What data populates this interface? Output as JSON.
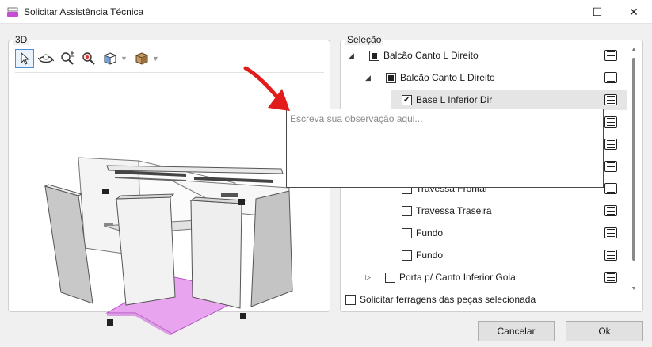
{
  "window": {
    "title": "Solicitar Assistência Técnica",
    "accent": "#c84bd6",
    "controls": {
      "minimize": "—",
      "maximize": "☐",
      "close": "✕"
    }
  },
  "panel_3d": {
    "label": "3D",
    "toolbar": [
      {
        "icon": "cursor-icon",
        "selected": true
      },
      {
        "icon": "orbit-icon"
      },
      {
        "icon": "zoom-plus-minus-icon"
      },
      {
        "icon": "zoom-fit-icon"
      },
      {
        "icon": "view-cube-icon",
        "dropdown": true
      },
      {
        "icon": "box-material-icon",
        "dropdown": true
      }
    ],
    "highlight_color": "#e8a4ef"
  },
  "panel_selection": {
    "label": "Seleção",
    "tree": [
      {
        "label": "Balcão Canto L Direito",
        "state": "partial",
        "expander": "expanded"
      },
      {
        "label": "Balcão Canto L Direito",
        "state": "partial",
        "expander": "expanded"
      },
      {
        "label": "Base L Inferior Dir",
        "state": "checked",
        "highlighted": true
      },
      {
        "label": "",
        "state": "hidden"
      },
      {
        "label": "",
        "state": "hidden"
      },
      {
        "label": "",
        "state": "hidden"
      },
      {
        "label": "Travessa Frontal",
        "state": "unchecked"
      },
      {
        "label": "Travessa Traseira",
        "state": "unchecked"
      },
      {
        "label": "Fundo",
        "state": "unchecked"
      },
      {
        "label": "Fundo",
        "state": "unchecked"
      },
      {
        "label": "Porta p/ Canto Inferior Gola",
        "state": "unchecked",
        "expander": "collapsed"
      }
    ],
    "footer_checkbox": "Solicitar ferragens das peças selecionada"
  },
  "observation": {
    "placeholder": "Escreva sua observação aqui..."
  },
  "buttons": {
    "cancel": "Cancelar",
    "ok": "Ok"
  },
  "annotation": {
    "arrow_color": "#e21b1b"
  }
}
